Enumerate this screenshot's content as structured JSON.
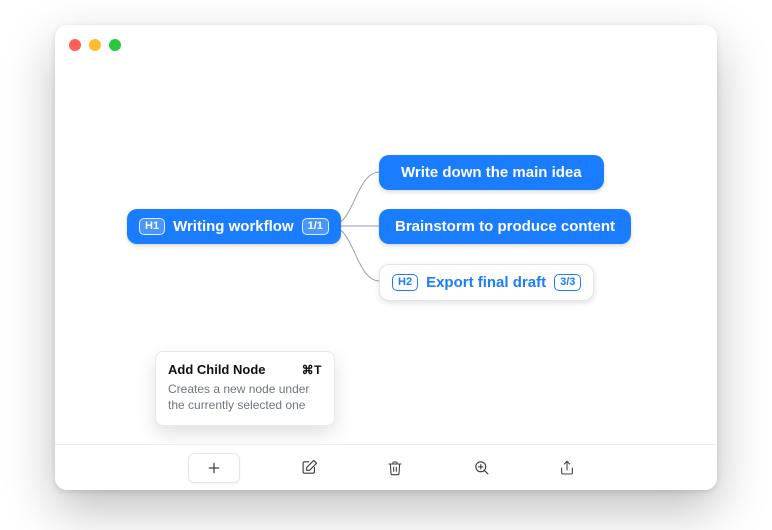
{
  "mindmap": {
    "root": {
      "badge": "H1",
      "label": "Writing workflow",
      "count": "1/1"
    },
    "children": [
      {
        "label": "Write down the main idea"
      },
      {
        "label": "Brainstorm to produce content"
      },
      {
        "badge": "H2",
        "label": "Export final draft",
        "count": "3/3"
      }
    ]
  },
  "tooltip": {
    "title": "Add Child Node",
    "shortcut": "⌘T",
    "description": "Creates a new node under the currently selected one"
  },
  "toolbar": {
    "add": "add-icon",
    "edit": "edit-icon",
    "delete": "trash-icon",
    "zoom": "zoom-in-icon",
    "share": "share-icon"
  },
  "colors": {
    "accent": "#1a7dff"
  }
}
